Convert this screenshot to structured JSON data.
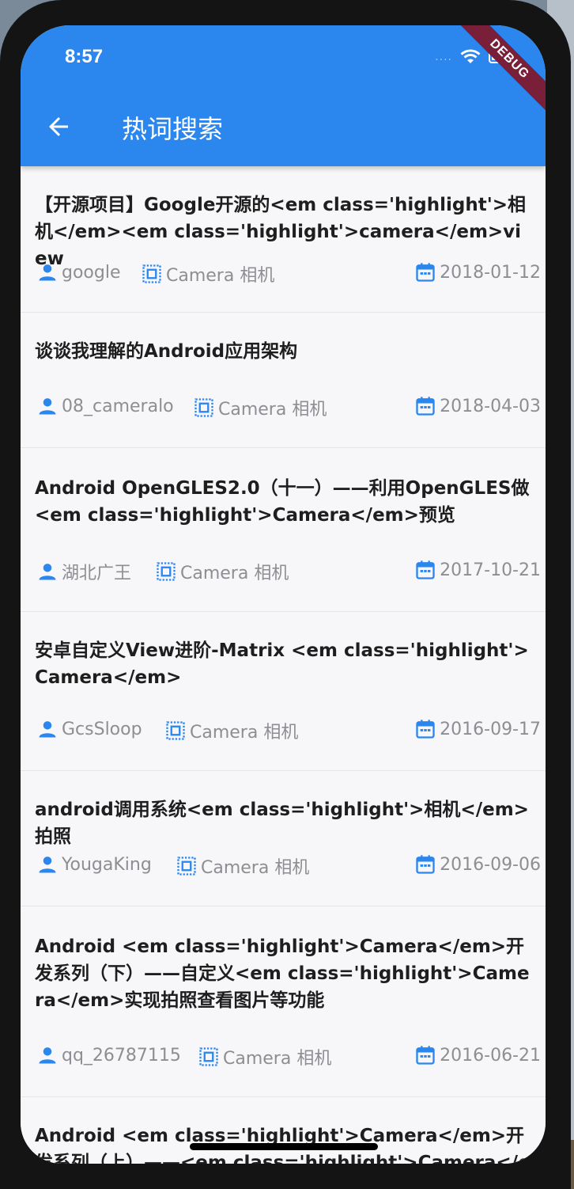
{
  "status_bar": {
    "time": "8:57",
    "signal": "....",
    "debug_banner": "DEBUG"
  },
  "app_bar": {
    "title": "热词搜索"
  },
  "colors": {
    "primary": "#2b86ee",
    "icon": "#2b86ee",
    "meta_text": "#8e8e92",
    "debug_ribbon": "#7a1f3a"
  },
  "icons": {
    "back": "arrow-left-icon",
    "author": "person-icon",
    "category": "chip-icon",
    "date": "calendar-icon"
  },
  "articles": [
    {
      "title": "【开源项目】Google开源的<em class='highlight'>相机</em><em class='highlight'>camera</em>view",
      "author": "google",
      "category": "Camera 相机",
      "date": "2018-01-12"
    },
    {
      "title": "谈谈我理解的Android应用架构",
      "author": "08_cameralo",
      "category": "Camera 相机",
      "date": "2018-04-03"
    },
    {
      "title": " Android OpenGLES2.0（十一）——利用OpenGLES做<em class='highlight'>Camera</em>预览",
      "author": "湖北广王",
      "category": "Camera 相机",
      "date": "2017-10-21"
    },
    {
      "title": "安卓自定义View进阶-Matrix <em class='highlight'>Camera</em>",
      "author": "GcsSloop",
      "category": "Camera 相机",
      "date": "2016-09-17"
    },
    {
      "title": "android调用系统<em class='highlight'>相机</em>拍照",
      "author": "YougaKing",
      "category": "Camera 相机",
      "date": "2016-09-06"
    },
    {
      "title": "Android <em class='highlight'>Camera</em>开发系列（下）——自定义<em class='highlight'>Camera</em>实现拍照查看图片等功能",
      "author": "qq_26787115",
      "category": "Camera 相机",
      "date": "2016-06-21"
    },
    {
      "title": "Android <em class='highlight'>Camera</em>开发系列（上）——<em class='highlight'>Camera</em>的",
      "author": "",
      "category": "",
      "date": ""
    }
  ]
}
